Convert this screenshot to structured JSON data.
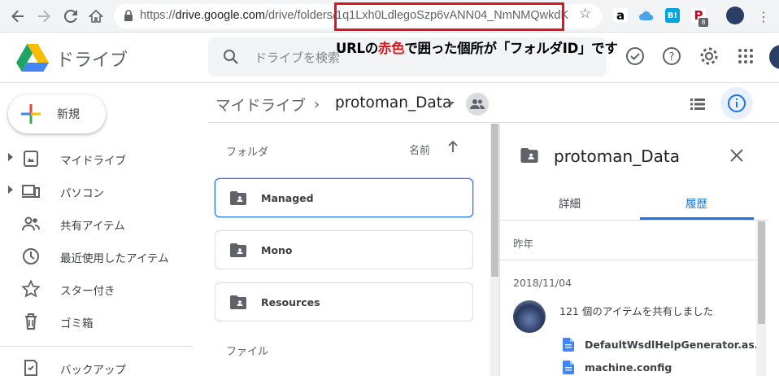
{
  "browser": {
    "url_prefix": "https://",
    "url_domain": "drive.google.com",
    "url_path": "/drive/folders/",
    "folder_id": "1q1Lxh0LdlegoSzp6vANN04_NmNMQwkdK",
    "extensions": [
      "amazon",
      "cloud",
      "B!",
      "P"
    ],
    "extension_badge": "8"
  },
  "header": {
    "app_name": "ドライブ",
    "search_placeholder": "ドライブを検索"
  },
  "annotation": {
    "caption_part1": "URLの",
    "caption_red": "赤色",
    "caption_part2": "で囲った個所が「フォルダID」です",
    "highlight_color": "#e0141e"
  },
  "sidebar": {
    "new_label": "新規",
    "items": [
      {
        "label": "マイドライブ",
        "icon": "my-drive-icon",
        "expandable": true
      },
      {
        "label": "パソコン",
        "icon": "computers-icon",
        "expandable": true
      },
      {
        "label": "共有アイテム",
        "icon": "shared-people-icon",
        "expandable": false
      },
      {
        "label": "最近使用したアイテム",
        "icon": "clock-icon",
        "expandable": false
      },
      {
        "label": "スター付き",
        "icon": "star-icon",
        "expandable": false
      },
      {
        "label": "ゴミ箱",
        "icon": "trash-icon",
        "expandable": false
      },
      {
        "label": "バックアップ",
        "icon": "backup-icon",
        "expandable": false
      }
    ]
  },
  "main": {
    "breadcrumb_root": "マイドライブ",
    "breadcrumb_sep": "›",
    "current_folder": "protoman_Data",
    "folders_label": "フォルダ",
    "sort_label": "名前",
    "files_label": "ファイル",
    "folders": [
      {
        "name": "Managed",
        "selected": true
      },
      {
        "name": "Mono",
        "selected": false
      },
      {
        "name": "Resources",
        "selected": false
      }
    ]
  },
  "details": {
    "title": "protoman_Data",
    "tab_details": "詳細",
    "tab_activity": "履歴",
    "active_tab": "履歴",
    "period": "昨年",
    "date": "2018/11/04",
    "activity": "121 個のアイテムを共有しました",
    "files": [
      "DefaultWsdlHelpGenerator.as...",
      "machine.config"
    ]
  },
  "colors": {
    "accent": "#1a73e8",
    "text": "#3c4043",
    "muted": "#5f6368"
  }
}
